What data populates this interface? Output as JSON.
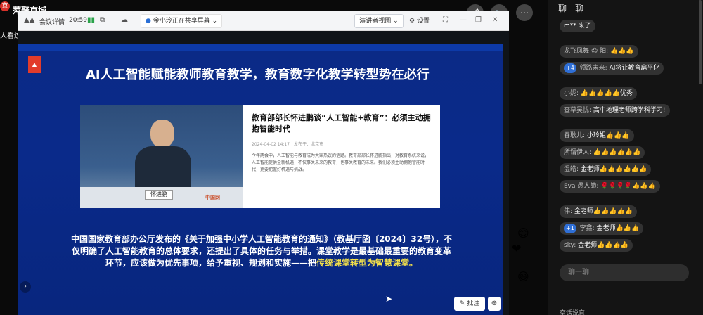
{
  "live": {
    "logo": "京",
    "title": "萍聚京城",
    "viewers": "人看过",
    "controls": [
      "⤴",
      "🔈",
      "⋯"
    ]
  },
  "meeting": {
    "app_name": "会议详情",
    "time": "20:59",
    "signal": "▮▮",
    "sharing_text": "金小玲正在共享屏幕",
    "view_label": "演讲者视图",
    "settings_label": "设置"
  },
  "slide": {
    "title": "AI人工智能赋能教师教育教学，教育数字化教学转型势在必行",
    "news_headline": "教育部部长怀进鹏谈“人工智能+教育”：必须主动拥抱智能时代",
    "news_meta": "2024-04-02 14:17　发布于：北京市",
    "news_body": "今年两会中，人工智能与教育成为大家热议的话题。教育部部长怀进鹏指出，对教育系统来说，人工智能提供全新机遇，不仅事关未来的教育，也事关教育的未来。我们必须主动拥抱智能时代，更要把握好机遇与挑战。",
    "nameplate": "怀进鹏",
    "watermark": "中国网",
    "paragraph_main": "中国国家教育部办公厅发布的《关于加强中小学人工智能教育的通知》（教基厅函〔2024〕32号），不仅明确了人工智能教育的总体要求，还提出了具体的任务与举措。课堂教学是最基础最重要的教育变革环节，应该做为优先事项，给予重视、规划和实施——把",
    "paragraph_highlight": "传统课堂转型为智慧课堂。",
    "annotate_label": "✎ 批注",
    "zoom_label": "⊕"
  },
  "chat": {
    "title": "聊一聊",
    "messages": [
      {
        "user": "",
        "text": "m** 来了"
      },
      {
        "user": "龙飞凤舞 ☺ 阳:",
        "text": "👍👍👍"
      },
      {
        "badge": "+4",
        "user": "领路未来:",
        "text": "AI将让教育扁平化"
      },
      {
        "user": "小妮:",
        "text": "👍👍👍👍👍优秀"
      },
      {
        "user": "查草吴忧:",
        "text": "高中地理老师跨学科学习!"
      },
      {
        "user": "春耿儿:",
        "text": "小玲姐👍👍👍"
      },
      {
        "user": "所谓伊人:",
        "text": "👍👍👍👍👍👍"
      },
      {
        "user": "温皓:",
        "text": "金老师👍👍👍👍👍👍"
      },
      {
        "user": "Eva 愚人節:",
        "text": "🌹🌹🌹🌹👍👍👍"
      },
      {
        "user": "伟:",
        "text": "金老师👍👍👍👍👍"
      },
      {
        "badge": "+1",
        "user": "李鑫:",
        "text": "金老师👍👍👍"
      },
      {
        "user": "sky:",
        "text": "金老师👍👍👍👍"
      }
    ],
    "input_placeholder": "聊一聊",
    "bottom_text": "空话说直"
  }
}
